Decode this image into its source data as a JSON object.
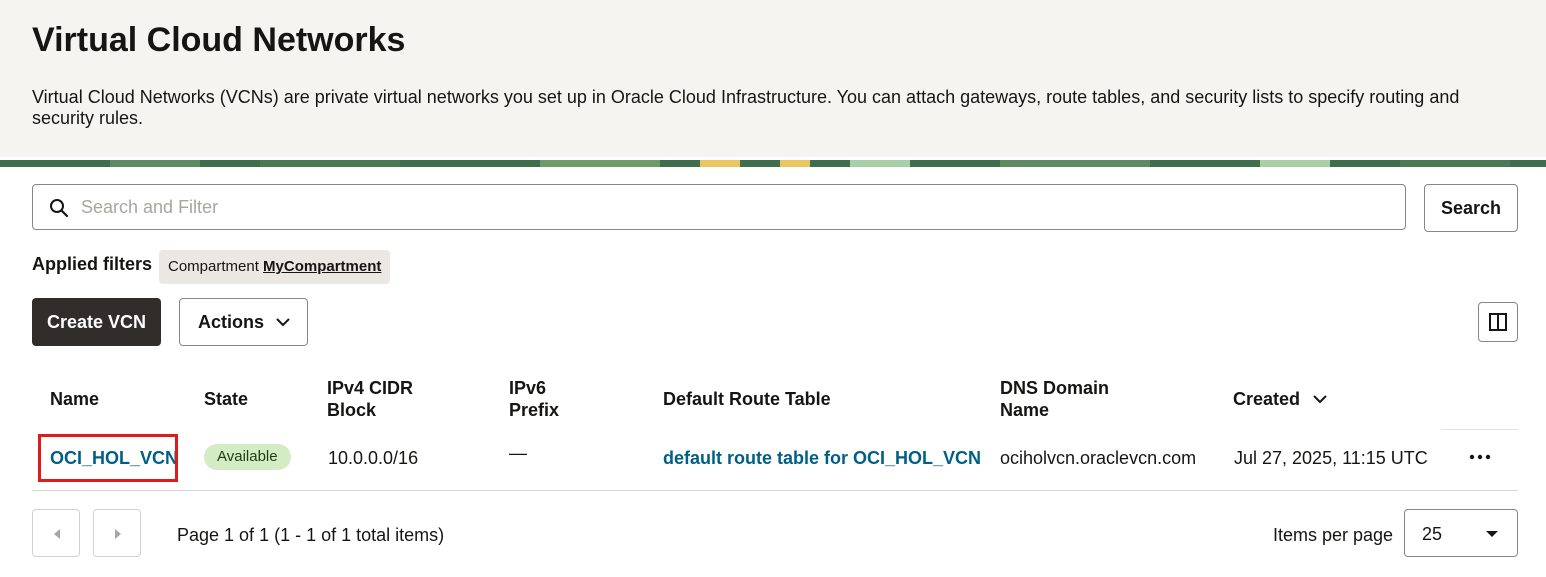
{
  "header": {
    "title": "Virtual Cloud Networks",
    "description": "Virtual Cloud Networks (VCNs) are private virtual networks you set up in Oracle Cloud Infrastructure. You can attach gateways, route tables, and security lists to specify routing and security rules."
  },
  "search": {
    "placeholder": "Search and Filter",
    "button_label": "Search",
    "icon": "search-icon"
  },
  "filters": {
    "label": "Applied filters",
    "chip_key": "Compartment",
    "chip_value": "MyCompartment"
  },
  "toolbar": {
    "create_label": "Create VCN",
    "actions_label": "Actions",
    "columns_icon": "columns-icon"
  },
  "table": {
    "columns": {
      "name": "Name",
      "state": "State",
      "ipv4_line1": "IPv4 CIDR",
      "ipv4_line2": "Block",
      "ipv6_line1": "IPv6",
      "ipv6_line2": "Prefix",
      "route": "Default Route Table",
      "dns_line1": "DNS Domain",
      "dns_line2": "Name",
      "created": "Created"
    },
    "rows": [
      {
        "name": "OCI_HOL_VCN",
        "state": "Available",
        "ipv4": "10.0.0.0/16",
        "ipv6": "—",
        "route": "default route table for OCI_HOL_VCN",
        "dns": "ociholvcn.oraclevcn.com",
        "created": "Jul 27, 2025, 11:15 UTC",
        "menu": "⋯"
      }
    ]
  },
  "pagination": {
    "info": "Page 1 of 1 (1 - 1 of 1 total items)",
    "items_per_page_label": "Items per page",
    "items_per_page": "25"
  },
  "colors": {
    "header_bg": "#f6f4f1",
    "primary_button": "#312d2a",
    "link": "#005f86",
    "badge_bg": "#d4ecc4",
    "highlight": "#e01b1b"
  }
}
